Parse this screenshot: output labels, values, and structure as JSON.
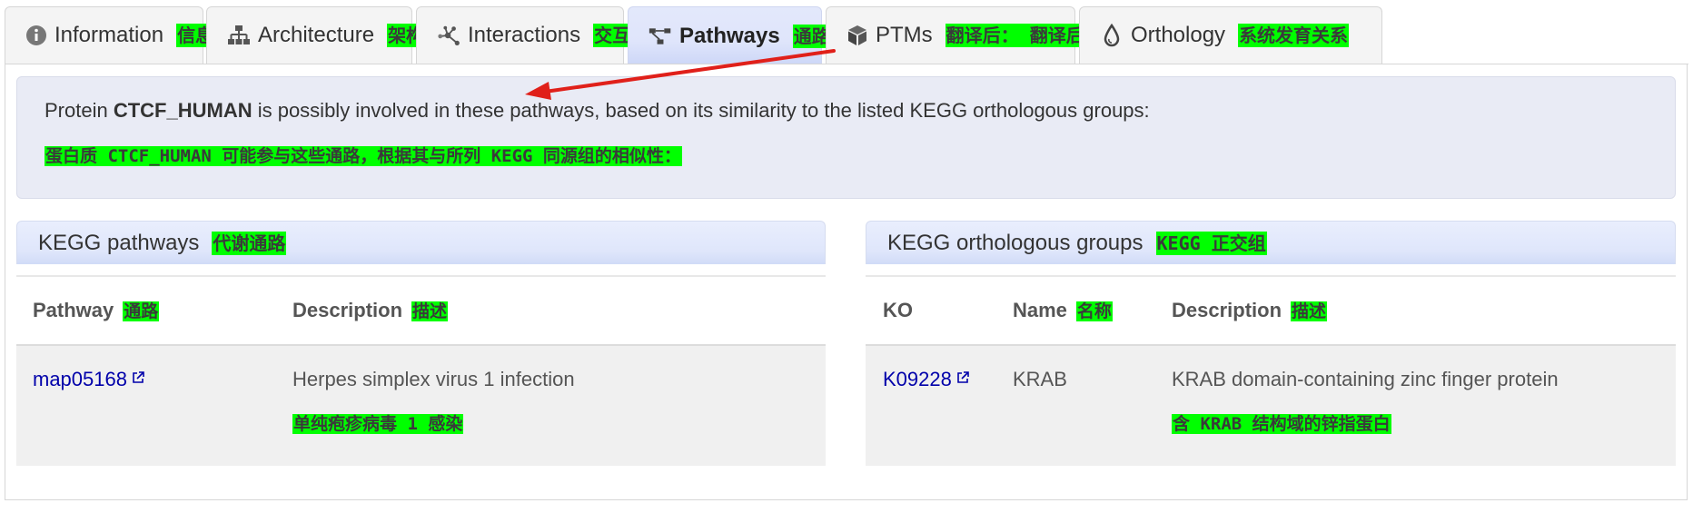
{
  "tabs": [
    {
      "label": "Information",
      "cn": "信息",
      "icon": "info-circle-icon"
    },
    {
      "label": "Architecture",
      "cn": "架构",
      "icon": "sitemap-icon"
    },
    {
      "label": "Interactions",
      "cn": "交互",
      "icon": "network-icon"
    },
    {
      "label": "Pathways",
      "cn": "通路",
      "icon": "pathway-icon"
    },
    {
      "label": "PTMs",
      "cn": "翻译后： 翻译后",
      "icon": "cube-icon"
    },
    {
      "label": "Orthology",
      "cn": "系统发育关系",
      "icon": "drop-icon"
    }
  ],
  "active_tab": "Pathways",
  "info": {
    "prefix": "Protein ",
    "protein": "CTCF_HUMAN",
    "suffix": " is possibly involved in these pathways, based on its similarity to the listed KEGG orthologous groups:",
    "cn": "蛋白质 CTCF_HUMAN 可能参与这些通路，根据其与所列 KEGG 同源组的相似性："
  },
  "kegg_pathways": {
    "title": "KEGG pathways",
    "title_cn": "代谢通路",
    "headers": {
      "pathway": "Pathway",
      "pathway_cn": "通路",
      "description": "Description",
      "description_cn": "描述"
    },
    "rows": [
      {
        "pathway": "map05168",
        "description": "Herpes simplex virus 1 infection",
        "description_cn": "单纯疱疹病毒 1 感染"
      }
    ]
  },
  "kegg_orthologous": {
    "title": "KEGG orthologous groups",
    "title_cn": "KEGG 正交组",
    "headers": {
      "ko": "KO",
      "name": "Name",
      "name_cn": "名称",
      "description": "Description",
      "description_cn": "描述"
    },
    "rows": [
      {
        "ko": "K09228",
        "name": "KRAB",
        "description": "KRAB domain-containing zinc finger protein",
        "description_cn": "含 KRAB 结构域的锌指蛋白"
      }
    ]
  },
  "colors": {
    "highlight": "#00ff00",
    "link": "#0000aa",
    "arrow": "#e0201a",
    "active_tab": "#dfe5fb"
  }
}
